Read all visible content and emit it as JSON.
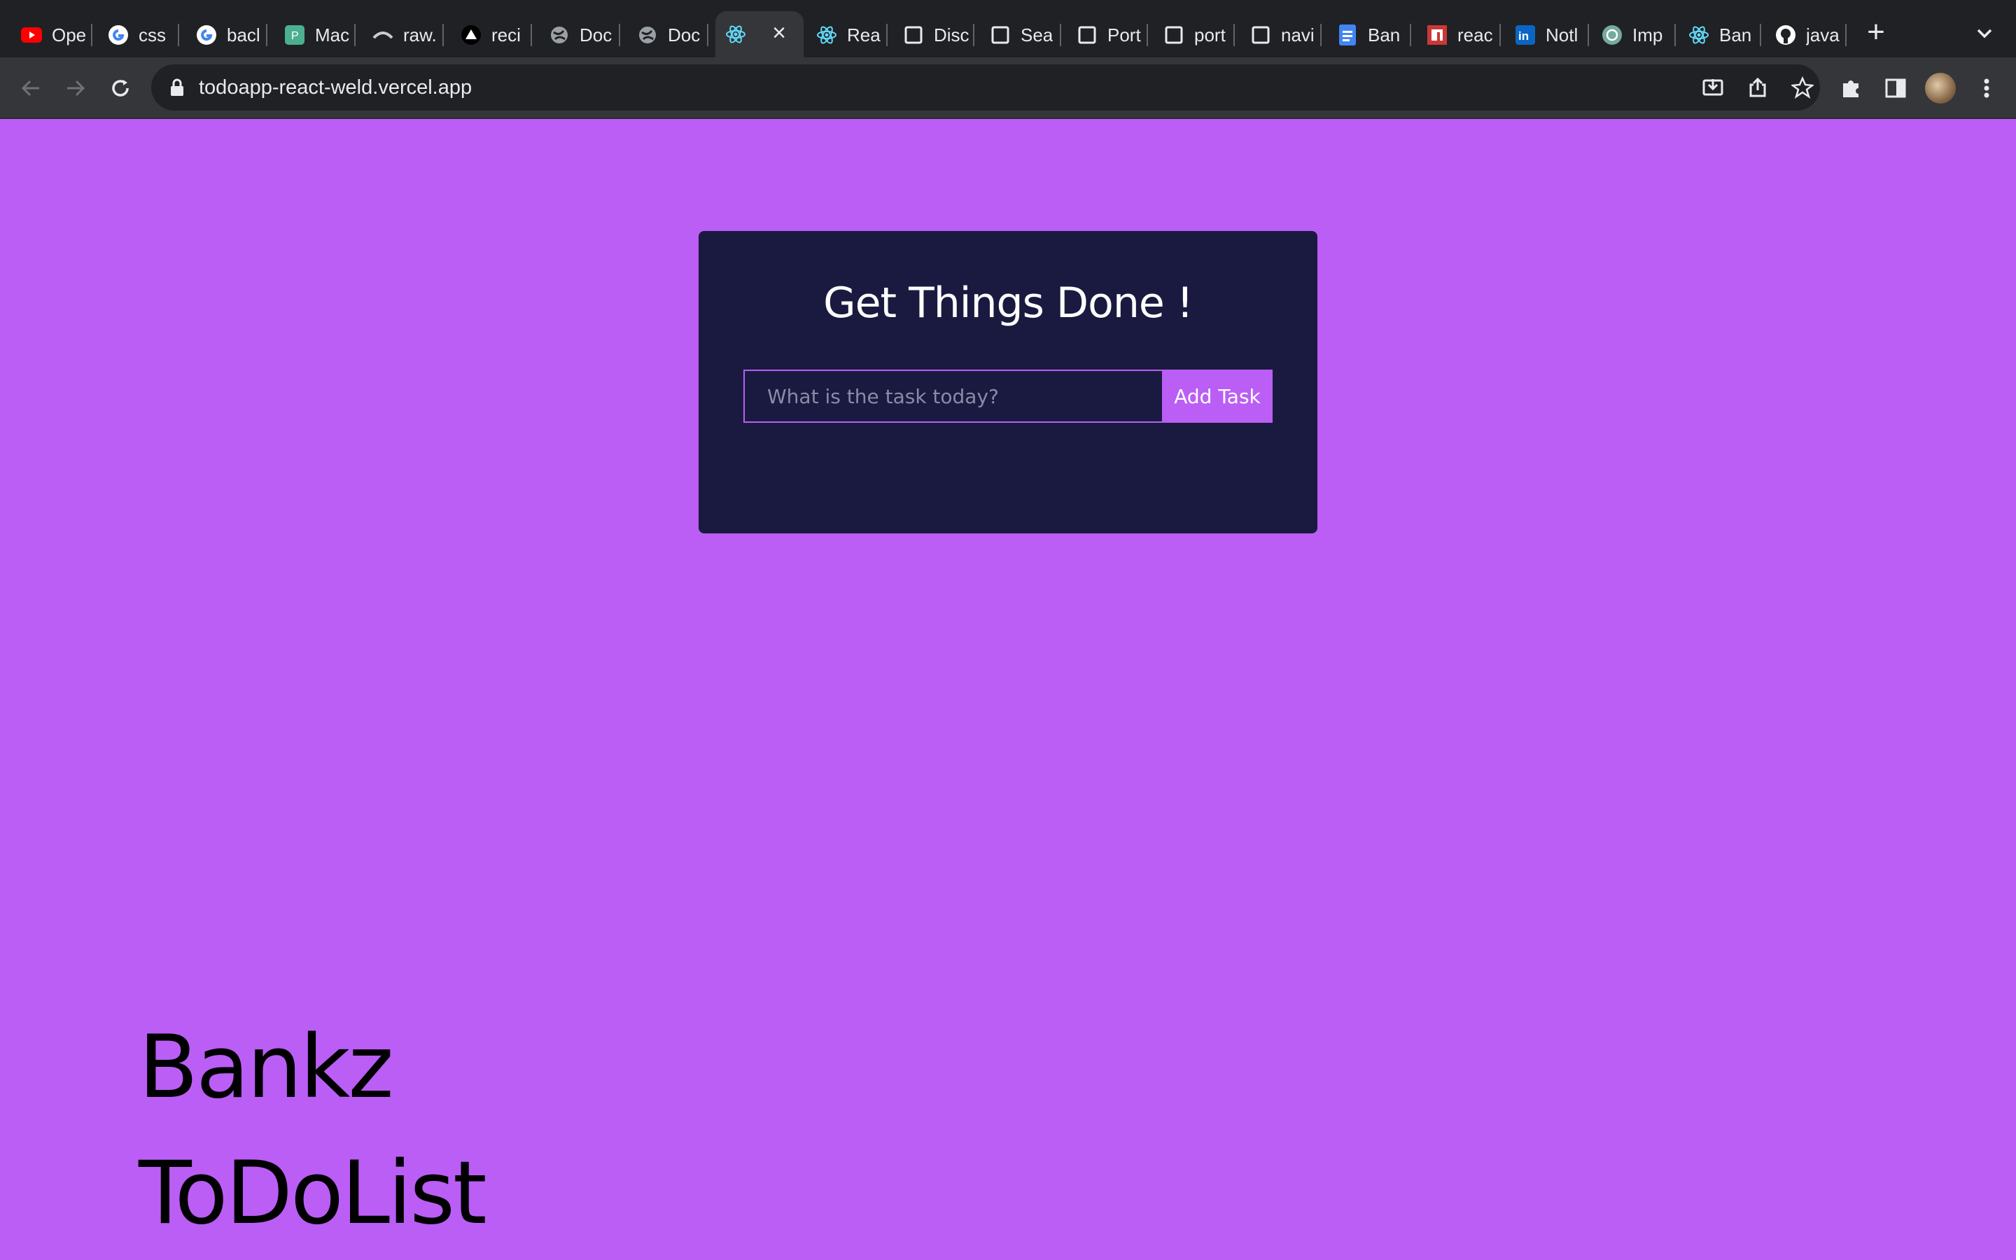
{
  "browser": {
    "tabs": [
      {
        "title": "Ope",
        "icon": "youtube-icon"
      },
      {
        "title": "css",
        "icon": "google-icon"
      },
      {
        "title": "bacl",
        "icon": "google-icon"
      },
      {
        "title": "Mac",
        "icon": "maccms-icon"
      },
      {
        "title": "raw.",
        "icon": "raw-icon"
      },
      {
        "title": "reci",
        "icon": "vercel-icon"
      },
      {
        "title": "Doc",
        "icon": "globe-icon"
      },
      {
        "title": "Doc",
        "icon": "globe-icon"
      },
      {
        "title": "",
        "icon": "react-icon",
        "active": true
      },
      {
        "title": "Rea",
        "icon": "react-icon"
      },
      {
        "title": "Disc",
        "icon": "page-icon"
      },
      {
        "title": "Sea",
        "icon": "page-icon"
      },
      {
        "title": "Port",
        "icon": "page-icon"
      },
      {
        "title": "port",
        "icon": "page-icon"
      },
      {
        "title": "navi",
        "icon": "page-icon"
      },
      {
        "title": "Ban",
        "icon": "docs-icon"
      },
      {
        "title": "reac",
        "icon": "npm-icon"
      },
      {
        "title": "Notl",
        "icon": "linkedin-icon"
      },
      {
        "title": "Imp",
        "icon": "openai-icon"
      },
      {
        "title": "Ban",
        "icon": "react-icon"
      },
      {
        "title": "java",
        "icon": "github-icon"
      }
    ],
    "url": "todoapp-react-weld.vercel.app"
  },
  "app": {
    "title": "Get Things Done !",
    "input_placeholder": "What is the task today?",
    "add_button": "Add Task",
    "brand_line1": "Bankz",
    "brand_line2": "ToDoList"
  },
  "colors": {
    "background": "#ba5ef5",
    "card": "#1a1a40",
    "accent": "#ba5ef5"
  }
}
